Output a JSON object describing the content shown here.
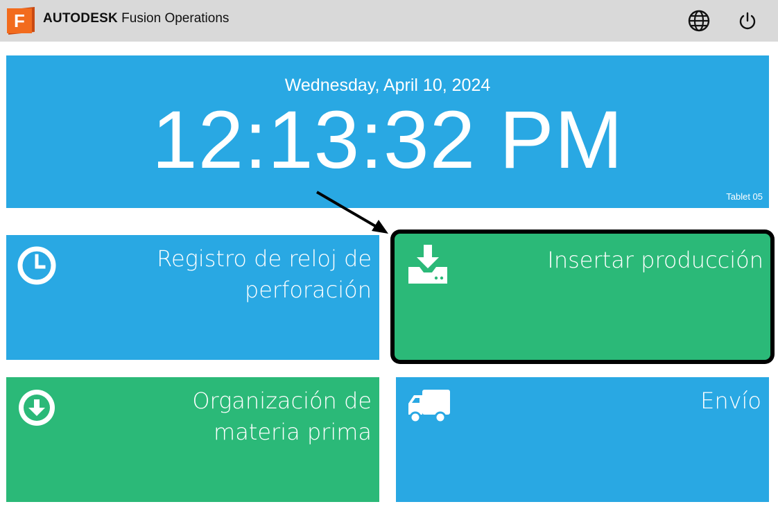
{
  "header": {
    "brand_bold": "AUTODESK",
    "brand_product": "Fusion Operations",
    "logo_letter": "F",
    "icons": [
      "globe-icon",
      "power-icon"
    ]
  },
  "clock": {
    "date": "Wednesday, April 10, 2024",
    "time": "12:13:32 PM",
    "device": "Tablet 05"
  },
  "tiles": [
    {
      "label": "Registro de reloj de perforación",
      "icon": "clock-icon",
      "color": "#29a8e3"
    },
    {
      "label": "Insertar producción",
      "icon": "inbox-download-icon",
      "color": "#2bb978",
      "highlighted": true
    },
    {
      "label": "Organización de materia prima",
      "icon": "arrow-down-circle-icon",
      "color": "#2bb978"
    },
    {
      "label": "Envío",
      "icon": "truck-icon",
      "color": "#29a8e3"
    }
  ],
  "colors": {
    "header_bg": "#d9d9d9",
    "blue": "#29a8e3",
    "green": "#2bb978",
    "logo_orange": "#f26b1d"
  }
}
